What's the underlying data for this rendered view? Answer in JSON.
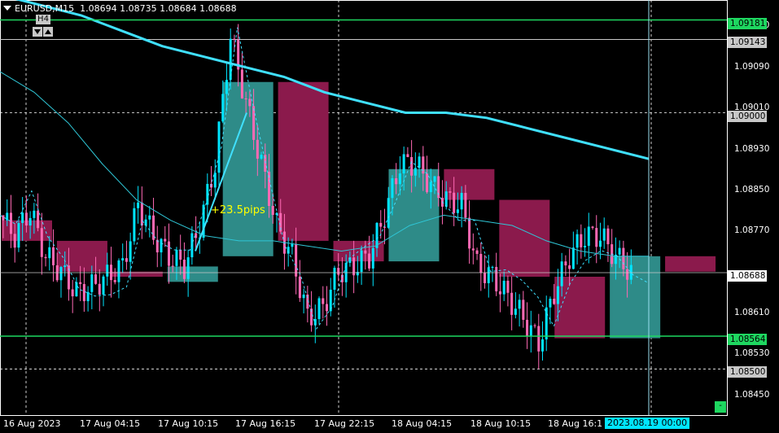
{
  "header": {
    "symbol_tf": "EURUSD,M15",
    "ohlc": "1.08694 1.08735 1.08684 1.08688",
    "higher_tf": "H4"
  },
  "price_axis": {
    "ticks": [
      "1.09170",
      "1.09090",
      "1.09010",
      "1.08930",
      "1.08850",
      "1.08770",
      "1.08610",
      "1.08530",
      "1.08450"
    ],
    "labels": {
      "top_line": "1.09181",
      "level_a": "1.09143",
      "level_b": "1.09000",
      "current": "1.08688",
      "bottom_line": "1.08564",
      "level_c": "1.08500"
    }
  },
  "time_axis": {
    "ticks": [
      "16 Aug 2023",
      "17 Aug 04:15",
      "17 Aug 10:15",
      "17 Aug 16:15",
      "17 Aug 22:15",
      "18 Aug 04:15",
      "18 Aug 10:15",
      "18 Aug 16:1"
    ],
    "crosshair": "2023.08.19 00:00"
  },
  "annotation": {
    "pips": "+23.5pips"
  },
  "mini_button": "-",
  "colors": {
    "bull": "#00e5ff",
    "bear": "#ff69b4",
    "h4_bull": "#2e8b88",
    "h4_bear": "#8b1a4c",
    "ma_slow": "#40e0ff",
    "level_green": "#1ed760"
  },
  "chart_data": {
    "type": "candlestick",
    "symbol": "EURUSD",
    "timeframe": "M15",
    "ylim": [
      1.0841,
      1.0922
    ],
    "h4_boxes": [
      {
        "open": 1.0879,
        "close": 1.0875,
        "dir": "bear"
      },
      {
        "open": 1.0875,
        "close": 1.0869,
        "dir": "bear"
      },
      {
        "open": 1.0869,
        "close": 1.0868,
        "dir": "bear"
      },
      {
        "open": 1.0867,
        "close": 1.087,
        "dir": "bull"
      },
      {
        "open": 1.0872,
        "close": 1.0906,
        "dir": "bull"
      },
      {
        "open": 1.0906,
        "close": 1.0875,
        "dir": "bear"
      },
      {
        "open": 1.0875,
        "close": 1.0871,
        "dir": "bear"
      },
      {
        "open": 1.0871,
        "close": 1.0889,
        "dir": "bull"
      },
      {
        "open": 1.0889,
        "close": 1.0883,
        "dir": "bear"
      },
      {
        "open": 1.0883,
        "close": 1.0868,
        "dir": "bear"
      },
      {
        "open": 1.0868,
        "close": 1.0856,
        "dir": "bear"
      },
      {
        "open": 1.0856,
        "close": 1.0872,
        "dir": "bull"
      },
      {
        "open": 1.0872,
        "close": 1.0869,
        "dir": "bear"
      }
    ],
    "ma_slow": [
      1.0923,
      1.0921,
      1.0919,
      1.0916,
      1.0913,
      1.0911,
      1.0909,
      1.0907,
      1.0904,
      1.0902,
      1.09,
      1.09,
      1.0899,
      1.0897,
      1.0895,
      1.0893,
      1.0891
    ],
    "ma_fast": [
      1.0908,
      1.0904,
      1.0898,
      1.089,
      1.0883,
      1.0879,
      1.0876,
      1.0875,
      1.0875,
      1.0874,
      1.0873,
      1.0874,
      1.0878,
      1.088,
      1.0879,
      1.0878,
      1.0875,
      1.0873,
      1.0872,
      1.0872
    ],
    "close_path": [
      1.088,
      1.0876,
      1.0881,
      1.0872,
      1.0869,
      1.0865,
      1.0866,
      1.0868,
      1.087,
      1.0882,
      1.0876,
      1.0872,
      1.087,
      1.0878,
      1.089,
      1.0915,
      1.0902,
      1.089,
      1.0878,
      1.0872,
      1.086,
      1.0862,
      1.0869,
      1.087,
      1.0872,
      1.088,
      1.089,
      1.089,
      1.0886,
      1.0883,
      1.0882,
      1.087,
      1.0868,
      1.0864,
      1.086,
      1.0855,
      1.0865,
      1.0872,
      1.0876,
      1.0876,
      1.0872,
      1.08688
    ]
  }
}
